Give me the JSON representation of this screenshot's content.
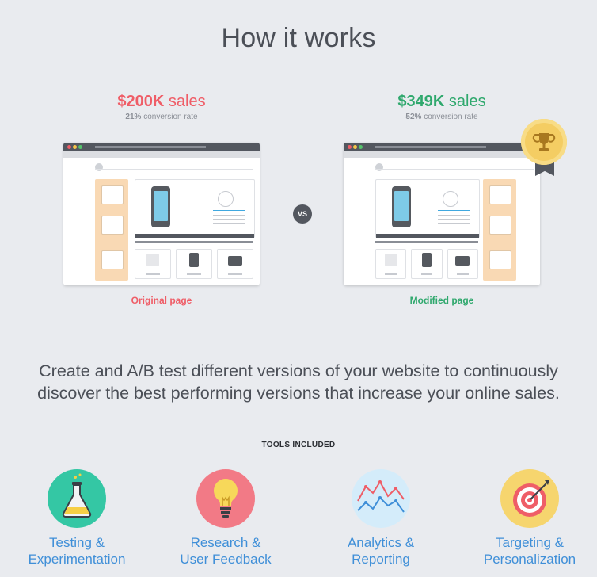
{
  "header": {
    "title": "How it works"
  },
  "variants": {
    "original": {
      "sales_amount": "$200K",
      "sales_suffix": "sales",
      "rate_value": "21%",
      "rate_suffix": "conversion rate",
      "caption": "Original page",
      "color": "#ef5d67"
    },
    "modified": {
      "sales_amount": "$349K",
      "sales_suffix": "sales",
      "rate_value": "52%",
      "rate_suffix": "conversion rate",
      "caption": "Modified page",
      "color": "#2fa86d"
    },
    "vs_label": "VS"
  },
  "description": "Create and A/B test different versions of your website to continuously discover the best performing versions that increase your online sales.",
  "tools": {
    "heading": "TOOLS INCLUDED",
    "items": [
      {
        "line1": "Testing &",
        "line2": "Experimentation",
        "icon": "flask-icon"
      },
      {
        "line1": "Research &",
        "line2": "User Feedback",
        "icon": "lightbulb-icon"
      },
      {
        "line1": "Analytics &",
        "line2": "Reporting",
        "icon": "line-chart-icon"
      },
      {
        "line1": "Targeting &",
        "line2": "Personalization",
        "icon": "target-icon"
      }
    ]
  },
  "colors": {
    "background": "#e9ebef",
    "link": "#3f8fd8"
  }
}
